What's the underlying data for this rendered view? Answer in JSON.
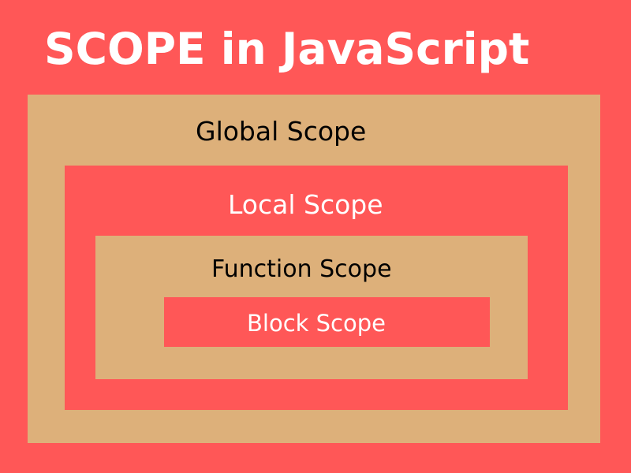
{
  "title": "SCOPE in JavaScript",
  "scopes": {
    "global": "Global Scope",
    "local": "Local Scope",
    "function": "Function Scope",
    "block": "Block Scope"
  },
  "colors": {
    "background": "#FF5757",
    "tan": "#DDB07A",
    "title_text": "#FFFFFF",
    "dark_text": "#000000",
    "light_text": "#FFFFFF"
  }
}
